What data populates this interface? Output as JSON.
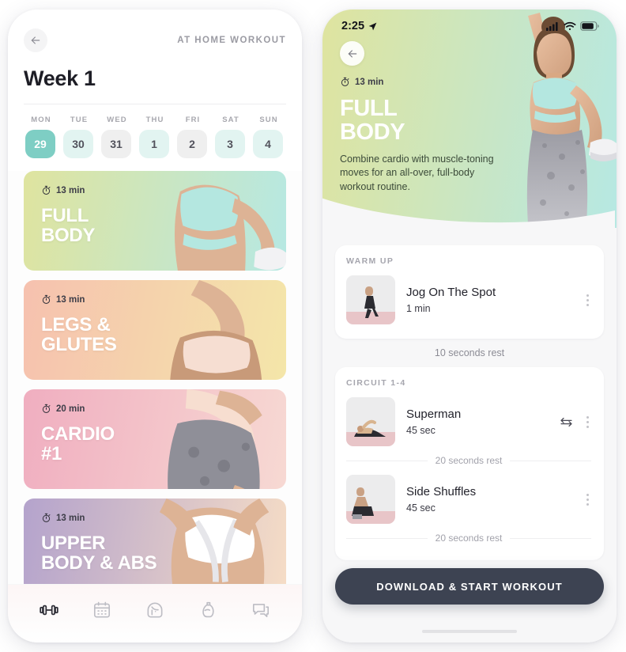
{
  "left_phone": {
    "back_icon": "arrow-left-icon",
    "header_label": "AT HOME WORKOUT",
    "week_title": "Week 1",
    "days": [
      {
        "dow": "MON",
        "num": "29",
        "state": "active"
      },
      {
        "dow": "TUE",
        "num": "30",
        "state": "teal"
      },
      {
        "dow": "WED",
        "num": "31",
        "state": "gray"
      },
      {
        "dow": "THU",
        "num": "1",
        "state": "teal"
      },
      {
        "dow": "FRI",
        "num": "2",
        "state": "gray"
      },
      {
        "dow": "SAT",
        "num": "3",
        "state": "teal"
      },
      {
        "dow": "SUN",
        "num": "4",
        "state": "teal"
      }
    ],
    "workouts": [
      {
        "duration": "13 min",
        "name": "FULL\nBODY",
        "grad_from": "#dfe49f",
        "grad_to": "#b6e8e3",
        "timer_icon": "stopwatch-icon"
      },
      {
        "duration": "13 min",
        "name": "LEGS &\nGLUTES",
        "grad_from": "#f6c1af",
        "grad_to": "#f4e6a9",
        "timer_icon": "stopwatch-icon"
      },
      {
        "duration": "20 min",
        "name": "CARDIO\n#1",
        "grad_from": "#f0aec0",
        "grad_to": "#f7d9d3",
        "timer_icon": "stopwatch-icon"
      },
      {
        "duration": "13 min",
        "name": "UPPER\nBODY & ABS",
        "grad_from": "#b4a3cc",
        "grad_to": "#f6ddc6",
        "timer_icon": "stopwatch-icon"
      },
      {
        "duration": "",
        "name": "",
        "grad_from": "#f0a8b6",
        "grad_to": "#efc9d6",
        "timer_icon": "stopwatch-icon"
      }
    ],
    "tabs": [
      {
        "icon": "dumbbell-icon",
        "name": "tab-workouts",
        "active": true
      },
      {
        "icon": "calendar-icon",
        "name": "tab-planner",
        "active": false
      },
      {
        "icon": "face-profile-icon",
        "name": "tab-community",
        "active": false
      },
      {
        "icon": "water-bottle-icon",
        "name": "tab-nutrition",
        "active": false
      },
      {
        "icon": "chat-bubble-icon",
        "name": "tab-messages",
        "active": false
      }
    ]
  },
  "right_phone": {
    "status": {
      "time": "2:25",
      "location_icon": "location-arrow-icon",
      "cellular_icon": "cellular-bars-icon",
      "wifi_icon": "wifi-icon",
      "battery_icon": "battery-icon"
    },
    "back_icon": "arrow-left-icon",
    "hero": {
      "duration": "13 min",
      "timer_icon": "stopwatch-icon",
      "title": "FULL\nBODY",
      "description": "Combine cardio with muscle-toning moves for an all-over, full-body workout routine.",
      "grad_from": "#dfe49f",
      "grad_to": "#b6e8e3"
    },
    "sections": [
      {
        "label": "WARM UP",
        "exercises": [
          {
            "name": "Jog On The Spot",
            "duration": "1 min",
            "swap": false,
            "menu_icon": "kebab-menu-icon",
            "rest_after": ""
          }
        ]
      },
      {
        "label": "CIRCUIT 1-4",
        "exercises": [
          {
            "name": "Superman",
            "duration": "45 sec",
            "swap": true,
            "swap_icon": "swap-arrows-icon",
            "menu_icon": "kebab-menu-icon",
            "rest_after": "20 seconds rest"
          },
          {
            "name": "Side Shuffles",
            "duration": "45 sec",
            "swap": false,
            "menu_icon": "kebab-menu-icon",
            "rest_after": "20 seconds rest"
          }
        ]
      }
    ],
    "between_rest": "10 seconds rest",
    "download_button": "DOWNLOAD & START WORKOUT",
    "button_color": "#3d4352"
  }
}
